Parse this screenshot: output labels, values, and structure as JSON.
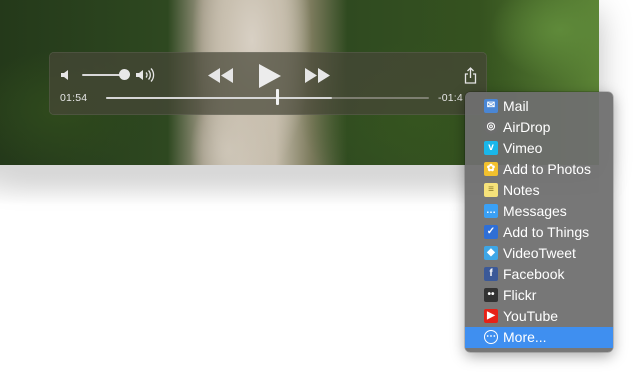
{
  "player": {
    "elapsed": "01:54",
    "remaining": "-01:4",
    "progress": 0.7,
    "volume": 0.9,
    "icons": [
      "volume-low-icon",
      "volume-high-icon",
      "rewind-icon",
      "play-icon",
      "fast-forward-icon",
      "share-icon"
    ]
  },
  "share_menu": {
    "items": [
      {
        "label": "Mail",
        "icon": "mail-icon",
        "color": "#4a86d4"
      },
      {
        "label": "AirDrop",
        "icon": "airdrop-icon",
        "color": "#6d6d6d"
      },
      {
        "label": "Vimeo",
        "icon": "vimeo-icon",
        "color": "#1ab7ea"
      },
      {
        "label": "Add to Photos",
        "icon": "photos-icon",
        "color": "#f2c12e"
      },
      {
        "label": "Notes",
        "icon": "notes-icon",
        "color": "#f6e27a"
      },
      {
        "label": "Messages",
        "icon": "messages-icon",
        "color": "#3aa0f5"
      },
      {
        "label": "Add to Things",
        "icon": "things-icon",
        "color": "#2f6fd6"
      },
      {
        "label": "VideoTweet",
        "icon": "videotweet-icon",
        "color": "#3ea6e6"
      },
      {
        "label": "Facebook",
        "icon": "facebook-icon",
        "color": "#3b5998"
      },
      {
        "label": "Flickr",
        "icon": "flickr-icon",
        "color": "#333333"
      },
      {
        "label": "YouTube",
        "icon": "youtube-icon",
        "color": "#e62117"
      },
      {
        "label": "More...",
        "icon": "more-icon",
        "color": "#3f8ff0"
      }
    ],
    "selected_index": 11,
    "selection_color": "#3f8ff0"
  }
}
